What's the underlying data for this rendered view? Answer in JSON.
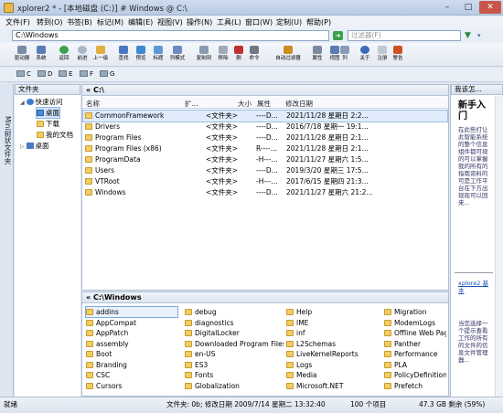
{
  "window": {
    "title": "xplorer2 * - [本地磁盘 (C:)] # Windows @ C:\\",
    "minimize": "–",
    "maximize": "□",
    "close": "✕"
  },
  "menu": [
    "文件(F)",
    "转到(O)",
    "书签(B)",
    "标记(M)",
    "编辑(E)",
    "视图(V)",
    "操作(N)",
    "工具(L)",
    "窗口(W)",
    "定制(U)",
    "帮助(P)"
  ],
  "address": {
    "value": "C:\\Windows",
    "filter_placeholder": "过滤器(F)"
  },
  "toolbar": [
    {
      "label": "驱动器",
      "color": "#7a8aa8"
    },
    {
      "label": "系统",
      "color": "#5a7bb5"
    },
    {
      "label": "返回",
      "color": "#3aa04a"
    },
    {
      "label": "前进",
      "color": "#aab6c8"
    },
    {
      "label": "上一级",
      "color": "#e0b040"
    },
    {
      "label": "查找",
      "color": "#4a78c0"
    },
    {
      "label": "预览",
      "color": "#3c8ad0"
    },
    {
      "label": "标题",
      "color": "#5a9ad8"
    },
    {
      "label": "列模式",
      "color": "#6a8ac0"
    },
    {
      "label": "复制到",
      "color": "#8a9ab0"
    },
    {
      "label": "移除",
      "color": "#a0aab8"
    },
    {
      "label": "删",
      "color": "#c03030"
    },
    {
      "label": "命令",
      "color": "#707880"
    },
    {
      "label": "自动过滤器",
      "color": "#d08a20"
    },
    {
      "label": "属性",
      "color": "#7a8aa0"
    },
    {
      "label": "视图",
      "color": "#5a7ab0"
    },
    {
      "label": "列",
      "color": "#8a9ab8"
    },
    {
      "label": "关于",
      "color": "#3a6ab8"
    },
    {
      "label": "注册",
      "color": "#c0c8d4"
    },
    {
      "label": "警告",
      "color": "#d05020"
    }
  ],
  "drives": [
    "C",
    "D",
    "E",
    "F",
    "G"
  ],
  "tree": {
    "header": "文件夹",
    "side_tab": "Mini树状文件夹",
    "items": [
      {
        "label": "快速访问"
      },
      {
        "label": "桌面"
      },
      {
        "label": "下载"
      },
      {
        "label": "我的文档"
      },
      {
        "label": "桌面"
      }
    ]
  },
  "pane_top": {
    "path": "« C:\\",
    "columns": [
      "名称",
      "扩...",
      "大小",
      "属性",
      "修改日期"
    ],
    "rows": [
      {
        "name": "CommonFramework",
        "size": "<文件夹>",
        "attr": "----D...",
        "date": "2021/11/28 星期日 2:2..."
      },
      {
        "name": "Drivers",
        "size": "<文件夹>",
        "attr": "----D...",
        "date": "2016/7/18 星期一 19:1..."
      },
      {
        "name": "Program Files",
        "size": "<文件夹>",
        "attr": "----D...",
        "date": "2021/11/28 星期日 2:1..."
      },
      {
        "name": "Program Files (x86)",
        "size": "<文件夹>",
        "attr": "R----...",
        "date": "2021/11/28 星期日 2:1..."
      },
      {
        "name": "ProgramData",
        "size": "<文件夹>",
        "attr": "-H---...",
        "date": "2021/11/27 星期六 1:5..."
      },
      {
        "name": "Users",
        "size": "<文件夹>",
        "attr": "----D...",
        "date": "2019/3/20 星期三 17:5..."
      },
      {
        "name": "VTRoot",
        "size": "<文件夹>",
        "attr": "-H---...",
        "date": "2017/6/15 星期四 21:3..."
      },
      {
        "name": "Windows",
        "size": "<文件夹>",
        "attr": "----D...",
        "date": "2021/11/27 星期六 21:2..."
      }
    ]
  },
  "pane_bottom": {
    "path": "« C:\\Windows",
    "items": [
      "addins",
      "AppCompat",
      "AppPatch",
      "assembly",
      "Boot",
      "Branding",
      "CSC",
      "Cursors",
      "debug",
      "diagnostics",
      "DigitalLocker",
      "Downloaded Program Files",
      "en-US",
      "ES3",
      "Fonts",
      "Globalization",
      "Help",
      "IME",
      "inf",
      "L2Schemas",
      "LiveKernelReports",
      "Logs",
      "Media",
      "Microsoft.NET",
      "Migration",
      "ModemLogs",
      "Offline Web Pages",
      "Panther",
      "Performance",
      "PLA",
      "PolicyDefinitions",
      "Prefetch"
    ]
  },
  "right_panel": {
    "header": "我该怎...",
    "heading": "新手入门",
    "paragraph": "在此些打让此智能系统的整个信息组件都可视的可以掌握我的所有的指南资料的可是工作平台在下方出现现可以回来...",
    "lower_text": "当您选择一个提示查看工作的所有的文件的信息文件管理器...",
    "link": "xplore2 基本"
  },
  "status": {
    "left": "就绪",
    "middle": "文件夹: 0b; 修改日期 2009/7/14 星期二 13:32:40",
    "count": "100 个项目",
    "disk": "47.3 GB 剩余 (59%)"
  }
}
